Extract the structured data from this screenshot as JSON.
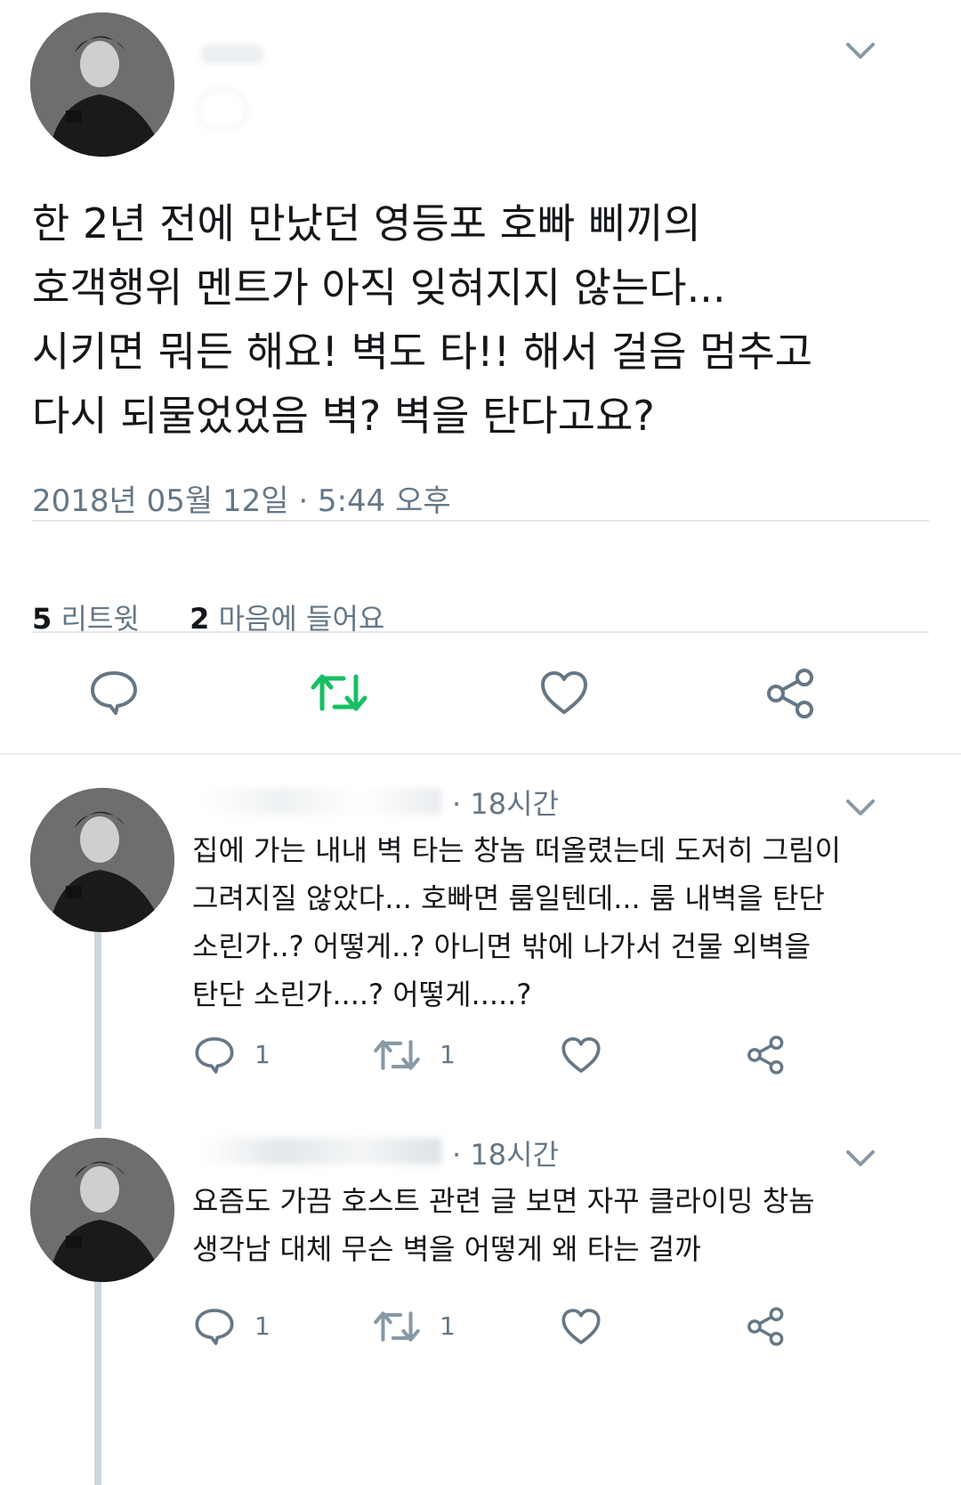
{
  "main_tweet": {
    "text": "한 2년 전에 만났던 영등포 호빠 삐끼의\n호객행위 멘트가 아직 잊혀지지 않는다...\n시키면 뭐든 해요! 벽도 타!! 해서 걸음 멈추고\n다시 되물었었음 벽? 벽을 탄다고요?",
    "date": "2018년 05월 12일 · 5:44 오후",
    "retweet_count": "5",
    "retweet_label": "리트윗",
    "like_count": "2",
    "like_label": "마음에 들어요"
  },
  "replies": [
    {
      "time": "· 18시간",
      "text": "집에 가는 내내 벽 타는 창놈 떠올렸는데 도저히 그림이\n그려지질 않았다... 호빠면 룸일텐데... 룸 내벽을 탄단\n소린가..? 어떻게..? 아니면 밖에 나가서 건물 외벽을\n탄단 소린가....? 어떻게.....?",
      "reply_count": "1",
      "retweet_count": "1"
    },
    {
      "time": "· 18시간",
      "text": "요즘도 가끔 호스트 관련 글 보면 자꾸 클라이밍 창놈\n생각남 대체 무슨 벽을 어떻게 왜 타는 걸까",
      "reply_count": "1",
      "retweet_count": "1"
    }
  ],
  "colors": {
    "text": "#14171a",
    "secondary": "#657786",
    "retweet_active": "#17bf63",
    "divider": "#e1e8ed",
    "thread_line": "#ccd6dd"
  },
  "icons": [
    "reply-icon",
    "retweet-icon",
    "like-icon",
    "share-icon",
    "chevron-down-icon"
  ]
}
